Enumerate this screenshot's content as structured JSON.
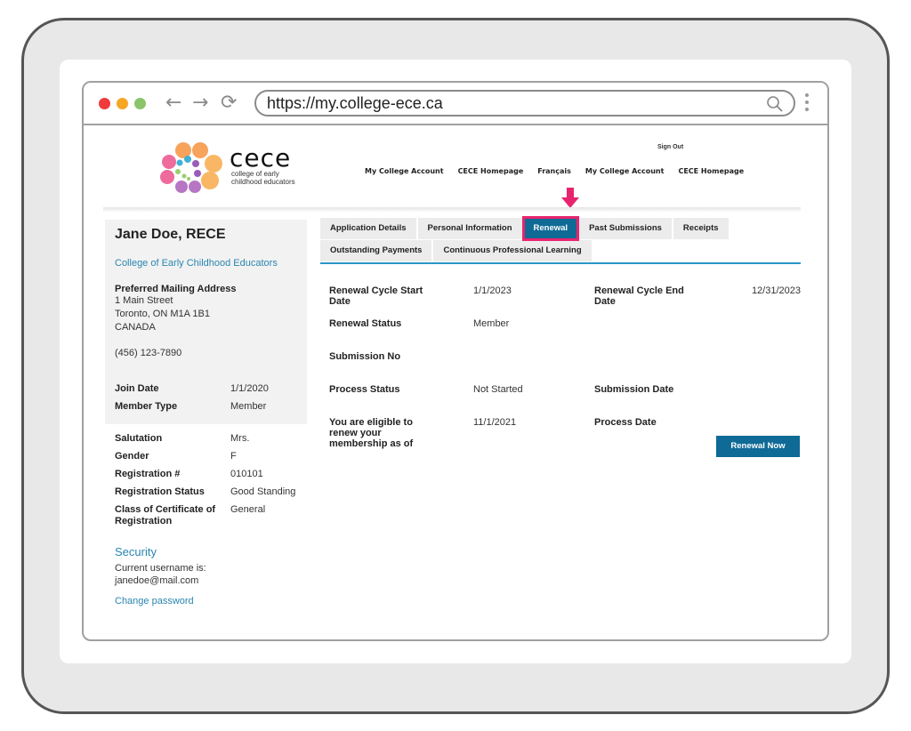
{
  "browser": {
    "url": "https://my.college-ece.ca",
    "back_icon": "arrow-left-icon",
    "forward_icon": "arrow-right-icon",
    "reload_icon": "reload-icon",
    "search_icon": "search-icon",
    "menu_icon": "kebab-menu-icon"
  },
  "header": {
    "logo_word": "cece",
    "logo_sub": "college of early childhood educators",
    "sign_out": "Sign Out",
    "nav": [
      "My College Account",
      "CECE Homepage",
      "Français",
      "My College Account",
      "CECE Homepage"
    ]
  },
  "colors": {
    "brand_blue": "#0f6a96",
    "link_blue": "#2a86b0",
    "highlight_pink": "#e8246e"
  },
  "sidebar": {
    "name": "Jane Doe, RECE",
    "organization": "College of Early Childhood Educators",
    "address_label": "Preferred Mailing Address",
    "address_lines": [
      "1 Main Street",
      "Toronto, ON  M1A 1B1",
      "CANADA"
    ],
    "phone": "(456) 123-7890",
    "membership": [
      {
        "label": "Join Date",
        "value": "1/1/2020"
      },
      {
        "label": "Member Type",
        "value": "Member"
      }
    ],
    "details": [
      {
        "label": "Salutation",
        "value": "Mrs."
      },
      {
        "label": "Gender",
        "value": "F"
      },
      {
        "label": "Registration #",
        "value": "010101"
      },
      {
        "label": "Registration Status",
        "value": "Good Standing"
      },
      {
        "label": "Class of Certificate of Registration",
        "value": "General"
      }
    ],
    "security": {
      "title": "Security",
      "username_label": "Current username is:",
      "username": "janedoe@mail.com",
      "change_password": "Change password"
    }
  },
  "tabs": {
    "row1": [
      "Application Details",
      "Personal Information",
      "Renewal",
      "Past Submissions",
      "Receipts"
    ],
    "row2": [
      "Outstanding Payments",
      "Continuous Professional Learning"
    ],
    "active": "Renewal"
  },
  "renewal": {
    "cycle_start_label": "Renewal Cycle Start Date",
    "cycle_start": "1/1/2023",
    "cycle_end_label": "Renewal Cycle End Date",
    "cycle_end": "12/31/2023",
    "status_label": "Renewal Status",
    "status": "Member",
    "submission_no_label": "Submission No",
    "submission_no": "",
    "process_status_label": "Process Status",
    "process_status": "Not Started",
    "submission_date_label": "Submission Date",
    "submission_date": "",
    "eligible_label": "You are eligible to renew your membership as of",
    "eligible_date": "11/1/2021",
    "process_date_label": "Process Date",
    "process_date": "",
    "renew_button": "Renewal Now"
  }
}
